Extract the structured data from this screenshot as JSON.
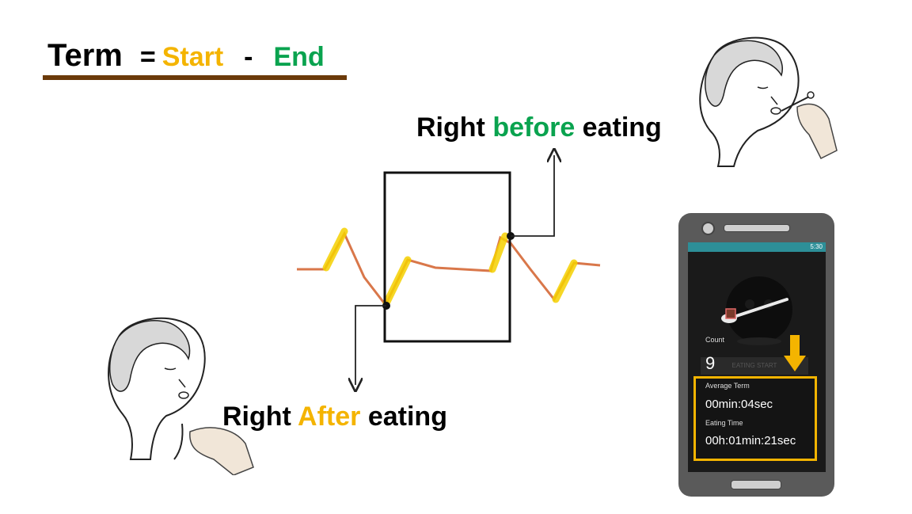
{
  "formula": {
    "term": "Term",
    "equals": "=",
    "start": "Start",
    "minus": "-",
    "end": "End"
  },
  "captions": {
    "before_prefix": "Right ",
    "before_highlight": "before",
    "before_suffix": " eating",
    "after_prefix": "Right ",
    "after_highlight": "After",
    "after_suffix": " eating"
  },
  "phone": {
    "status_time": "5:30",
    "count_label": "Count",
    "count_value": "9",
    "eating_start_label": "EATING START",
    "average_term_label": "Average Term",
    "average_term_value": "00min:04sec",
    "eating_time_label": "Eating Time",
    "eating_time_value": "00h:01min:21sec"
  },
  "colors": {
    "start": "#f4b400",
    "end": "#0aa34f",
    "underline": "#6b3a0a",
    "highlight_box": "#f4b400",
    "signal": "#d9774a",
    "signal_highlight": "#f4d000",
    "status_bar": "#2d8f98"
  },
  "icons": [
    "woman-eating-illustration",
    "spoon-icon",
    "down-arrow-icon"
  ]
}
